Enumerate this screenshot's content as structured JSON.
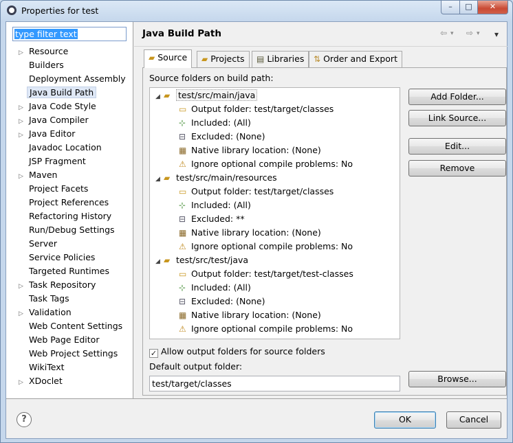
{
  "window": {
    "title": "Properties for test",
    "min_glyph": "–",
    "max_glyph": "□",
    "close_glyph": "✕"
  },
  "filter": {
    "value": "type filter text"
  },
  "nav": [
    {
      "label": "Resource",
      "expandable": true
    },
    {
      "label": "Builders",
      "expandable": false
    },
    {
      "label": "Deployment Assembly",
      "expandable": false
    },
    {
      "label": "Java Build Path",
      "expandable": false,
      "selected": true
    },
    {
      "label": "Java Code Style",
      "expandable": true
    },
    {
      "label": "Java Compiler",
      "expandable": true
    },
    {
      "label": "Java Editor",
      "expandable": true
    },
    {
      "label": "Javadoc Location",
      "expandable": false
    },
    {
      "label": "JSP Fragment",
      "expandable": false
    },
    {
      "label": "Maven",
      "expandable": true
    },
    {
      "label": "Project Facets",
      "expandable": false
    },
    {
      "label": "Project References",
      "expandable": false
    },
    {
      "label": "Refactoring History",
      "expandable": false
    },
    {
      "label": "Run/Debug Settings",
      "expandable": false
    },
    {
      "label": "Server",
      "expandable": false
    },
    {
      "label": "Service Policies",
      "expandable": false
    },
    {
      "label": "Targeted Runtimes",
      "expandable": false
    },
    {
      "label": "Task Repository",
      "expandable": true
    },
    {
      "label": "Task Tags",
      "expandable": false
    },
    {
      "label": "Validation",
      "expandable": true
    },
    {
      "label": "Web Content Settings",
      "expandable": false
    },
    {
      "label": "Web Page Editor",
      "expandable": false
    },
    {
      "label": "Web Project Settings",
      "expandable": false
    },
    {
      "label": "WikiText",
      "expandable": false
    },
    {
      "label": "XDoclet",
      "expandable": true
    }
  ],
  "page": {
    "title": "Java Build Path",
    "back_glyph": "⇦",
    "forward_glyph": "⇨",
    "dropdown_glyph": "▾"
  },
  "tabs": [
    {
      "label": "Source",
      "icon": "source-folder-icon",
      "active": true
    },
    {
      "label": "Projects",
      "icon": "projects-icon",
      "active": false
    },
    {
      "label": "Libraries",
      "icon": "libraries-icon",
      "active": false
    },
    {
      "label": "Order and Export",
      "icon": "order-export-icon",
      "active": false
    }
  ],
  "source": {
    "label": "Source folders on build path:",
    "folders": [
      {
        "name": "test/src/main/java",
        "children": [
          {
            "type": "output",
            "text": "Output folder: test/target/classes"
          },
          {
            "type": "included",
            "text": "Included: (All)"
          },
          {
            "type": "excluded",
            "text": "Excluded: (None)"
          },
          {
            "type": "native",
            "text": "Native library location: (None)"
          },
          {
            "type": "ignore",
            "text": "Ignore optional compile problems: No"
          }
        ]
      },
      {
        "name": "test/src/main/resources",
        "children": [
          {
            "type": "output",
            "text": "Output folder: test/target/classes"
          },
          {
            "type": "included",
            "text": "Included: (All)"
          },
          {
            "type": "excluded",
            "text": "Excluded: **"
          },
          {
            "type": "native",
            "text": "Native library location: (None)"
          },
          {
            "type": "ignore",
            "text": "Ignore optional compile problems: No"
          }
        ]
      },
      {
        "name": "test/src/test/java",
        "children": [
          {
            "type": "output",
            "text": "Output folder: test/target/test-classes"
          },
          {
            "type": "included",
            "text": "Included: (All)"
          },
          {
            "type": "excluded",
            "text": "Excluded: (None)"
          },
          {
            "type": "native",
            "text": "Native library location: (None)"
          },
          {
            "type": "ignore",
            "text": "Ignore optional compile problems: No"
          }
        ]
      }
    ],
    "buttons": {
      "add_folder": "Add Folder...",
      "link_source": "Link Source...",
      "edit": "Edit...",
      "remove": "Remove",
      "browse": "Browse..."
    },
    "allow_output_label": "Allow output folders for source folders",
    "allow_output_checked": true,
    "default_output_label": "Default output folder:",
    "default_output_value": "test/target/classes"
  },
  "footer": {
    "help_glyph": "?",
    "ok": "OK",
    "cancel": "Cancel"
  },
  "colors": {
    "selection": "#3399ff",
    "default_button_border": "#3c7fb1",
    "folder_icon": "#c8961e"
  }
}
